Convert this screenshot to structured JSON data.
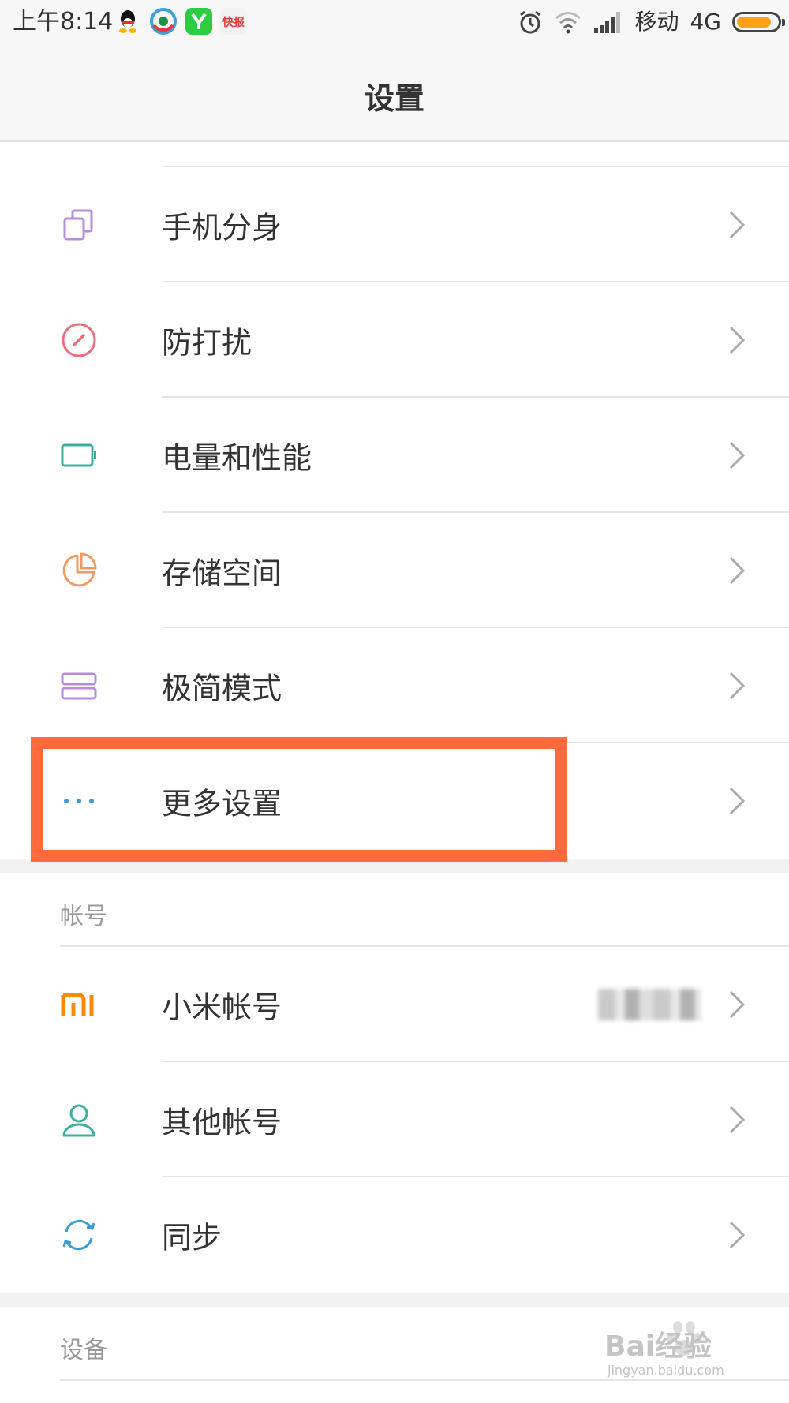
{
  "status_bar": {
    "time": "上午8:14",
    "carrier": "移动",
    "network": "4G",
    "battery_level": 0.85,
    "apps": [
      "qq-icon",
      "browser-icon",
      "green-app-icon",
      "news-app-icon"
    ],
    "news_app_text": "快报"
  },
  "header": {
    "title": "设置"
  },
  "settings": {
    "items": [
      {
        "label": "手机分身",
        "icon": "clone-icon",
        "color": "#b98be0"
      },
      {
        "label": "防打扰",
        "icon": "do-not-disturb-icon",
        "color": "#e8707a"
      },
      {
        "label": "电量和性能",
        "icon": "battery-icon",
        "color": "#3bb0a0"
      },
      {
        "label": "存储空间",
        "icon": "storage-pie-icon",
        "color": "#f29a5e"
      },
      {
        "label": "极简模式",
        "icon": "simple-mode-icon",
        "color": "#b98be0"
      },
      {
        "label": "更多设置",
        "icon": "more-dots-icon",
        "color": "#3a9bd5"
      }
    ]
  },
  "accounts": {
    "section_title": "帐号",
    "items": [
      {
        "label": "小米帐号",
        "icon": "mi-logo-icon",
        "color": "#ff8a00",
        "value": "●●●●●"
      },
      {
        "label": "其他帐号",
        "icon": "person-icon",
        "color": "#3bb0a0"
      },
      {
        "label": "同步",
        "icon": "sync-icon",
        "color": "#3a9bd5"
      }
    ]
  },
  "devices": {
    "section_title": "设备"
  },
  "watermark": {
    "text": "Bai经验",
    "subtext": "jingyan.baidu.com"
  },
  "annotation": {
    "color": "#ff6a3d"
  }
}
